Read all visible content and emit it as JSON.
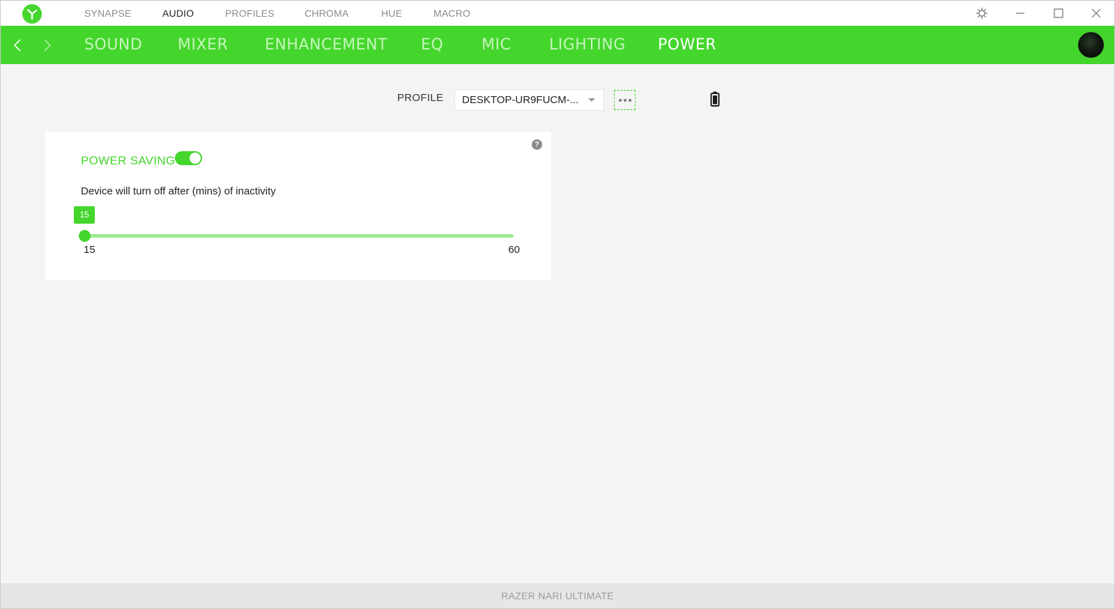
{
  "titlebar": {
    "tabs": [
      {
        "label": "SYNAPSE",
        "active": false
      },
      {
        "label": "AUDIO",
        "active": true
      },
      {
        "label": "PROFILES",
        "active": false
      },
      {
        "label": "CHROMA",
        "active": false
      },
      {
        "label": "HUE",
        "active": false
      },
      {
        "label": "MACRO",
        "active": false
      }
    ],
    "icons": [
      "razer-logo-icon",
      "settings-gear-icon",
      "minimize-icon",
      "maximize-icon",
      "close-icon"
    ]
  },
  "navbar": {
    "tabs": [
      {
        "label": "SOUND",
        "active": false
      },
      {
        "label": "MIXER",
        "active": false
      },
      {
        "label": "ENHANCEMENT",
        "active": false
      },
      {
        "label": "EQ",
        "active": false
      },
      {
        "label": "MIC",
        "active": false
      },
      {
        "label": "LIGHTING",
        "active": false
      },
      {
        "label": "POWER",
        "active": true
      }
    ],
    "icons": [
      "back-arrow-icon",
      "forward-arrow-icon",
      "user-avatar"
    ]
  },
  "profile": {
    "label": "PROFILE",
    "selected": "DESKTOP-UR9FUCM-..."
  },
  "power_saving": {
    "title": "POWER SAVING",
    "enabled": true,
    "description": "Device will turn off after (mins) of inactivity",
    "value": "15",
    "min": "15",
    "max": "60"
  },
  "footer": {
    "device_name": "RAZER NARI ULTIMATE"
  },
  "colors": {
    "accent": "#44d62c",
    "accent_light": "#9be98f",
    "background": "#f4f4f4"
  }
}
